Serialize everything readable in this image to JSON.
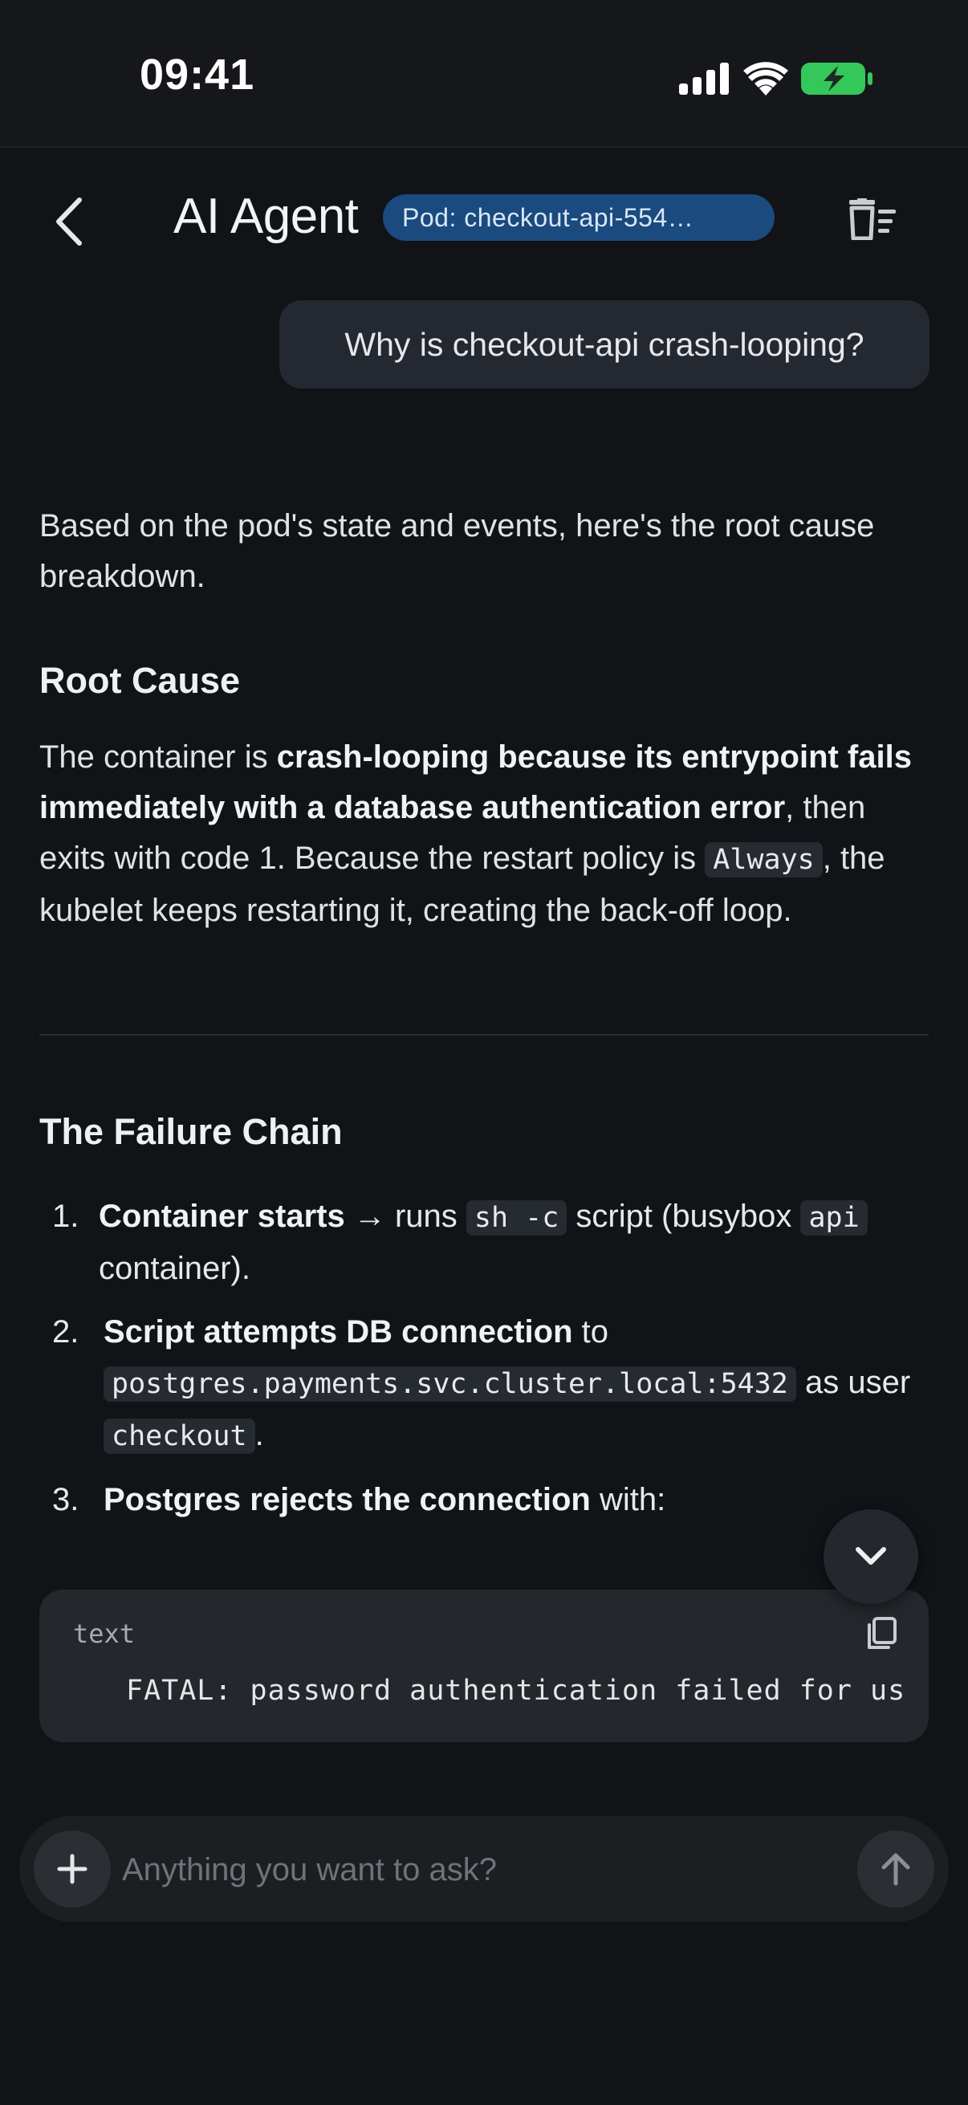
{
  "status_bar": {
    "time": "09:41"
  },
  "header": {
    "title": "AI Agent",
    "pod_chip": "Pod: checkout-api-554…"
  },
  "user_message": "Why is checkout-api crash-looping?",
  "assistant": {
    "intro": "Based on the pod's state and events, here's the root cause breakdown.",
    "root_cause": {
      "heading": "Root Cause",
      "p1_a": "The container is ",
      "p1_bold": "crash-looping because its entrypoint fails immediately with a database authentication error",
      "p1_b": ", then exits with code 1. Because the restart policy is ",
      "p1_code": "Always",
      "p1_c": ", the kubelet keeps restarting it, creating the back-off loop."
    },
    "failure_chain": {
      "heading": "The Failure Chain",
      "items": [
        {
          "num": "1.",
          "bold": "Container starts",
          "a": " → runs ",
          "code1": "sh -c",
          "b": " script (busybox ",
          "code2": "api",
          "c": " container)."
        },
        {
          "num": "2.",
          "bold": "Script attempts DB connection",
          "a": " to ",
          "code1": "postgres.payments.svc.cluster.local:5432",
          "b": " as user ",
          "code2": "checkout",
          "c": "."
        },
        {
          "num": "3.",
          "bold": "Postgres rejects the connection",
          "a": " with:"
        }
      ]
    },
    "code_block": {
      "lang": "text",
      "content": "FATAL: password authentication failed for us"
    }
  },
  "composer": {
    "placeholder": "Anything you want to ask?"
  },
  "icons": {
    "back": "chevron-left-icon",
    "clear": "clear-chat-icon",
    "scroll": "chevron-down-icon",
    "copy": "copy-icon",
    "plus": "plus-icon",
    "send": "arrow-up-icon"
  },
  "colors": {
    "background": "#111317",
    "chip": "#1a4a7e",
    "battery": "#34c759"
  }
}
